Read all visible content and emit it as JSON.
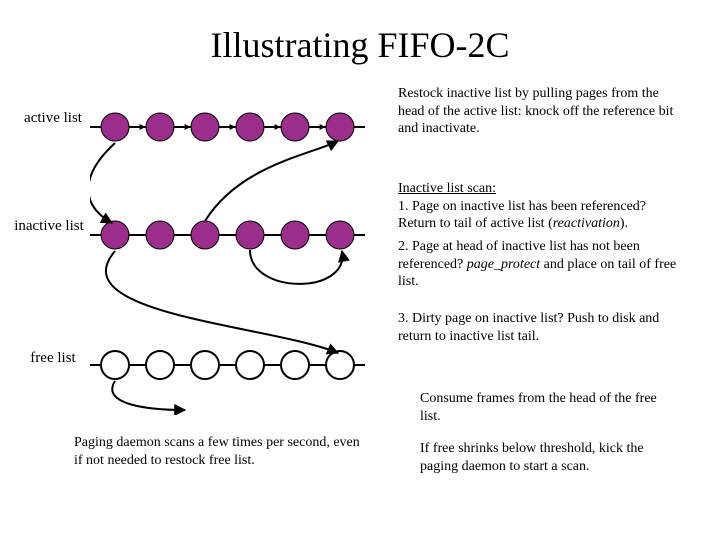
{
  "title": "Illustrating FIFO-2C",
  "labels": {
    "active": "active list",
    "inactive": "inactive list",
    "free": "free list"
  },
  "text": {
    "block1": "Restock inactive list by pulling pages from the head of the active list: knock off the reference bit and inactivate.",
    "block2_underline": "Inactive list scan:",
    "block2_line1": "1. Page on inactive list has been referenced? Return to tail of active list (",
    "block2_italic": "reactivation",
    "block2_tail": ").",
    "block3_pre": "2. Page at head of inactive list has not been referenced? ",
    "block3_italic": "page_protect",
    "block3_post": " and place on tail of free list.",
    "block4": "3. Dirty page on inactive list? Push to disk and return to inactive list tail.",
    "caption": "Paging daemon scans a few times per second, even if not needed to restock free list.",
    "block5": "Consume frames from the head of the free list.",
    "block6": "If free shrinks below threshold, kick the paging daemon to start a scan."
  },
  "chart_data": {
    "type": "diagram",
    "lists": [
      {
        "name": "active list",
        "nodes": 6,
        "filled": true,
        "arrows": [
          {
            "desc": "head of active to head of inactive",
            "from": "active[0]",
            "to": "inactive[0]"
          }
        ]
      },
      {
        "name": "inactive list",
        "nodes": 6,
        "filled": true,
        "arrows": [
          {
            "desc": "reactivation: inactive to tail of active",
            "from": "inactive[*]",
            "to": "active[5]"
          },
          {
            "desc": "head of inactive to tail of free",
            "from": "inactive[0]",
            "to": "free[5]"
          },
          {
            "desc": "dirty page loop back to inactive tail",
            "from": "inactive[*]",
            "to": "inactive[5]"
          }
        ]
      },
      {
        "name": "free list",
        "nodes": 6,
        "filled": false,
        "arrows": [
          {
            "desc": "consume from head of free",
            "from": "free[0]",
            "to": "out"
          }
        ]
      }
    ]
  }
}
